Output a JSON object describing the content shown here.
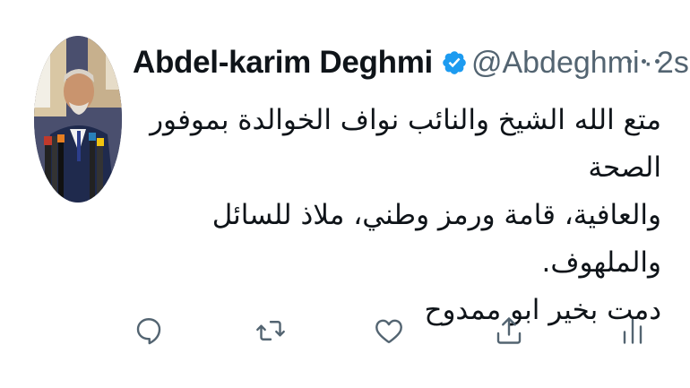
{
  "author": {
    "display_name": "Abdel-karim Deghmi",
    "verified": true,
    "handle": "@Abdeghmi",
    "separator": "·",
    "time": "2s"
  },
  "tweet": {
    "lines": [
      "متع الله الشيخ والنائب نواف الخوالدة بموفور الصحة",
      "والعافية، قامة ورمز وطني، ملاذ للسائل والملهوف.",
      "دمت بخير ابو ممدوح"
    ]
  },
  "actions": [
    {
      "icon": "reply-icon"
    },
    {
      "icon": "retweet-icon"
    },
    {
      "icon": "like-icon"
    },
    {
      "icon": "share-icon"
    },
    {
      "icon": "views-icon"
    }
  ],
  "colors": {
    "text": "#0f1419",
    "secondary": "#536471",
    "verified": "#1d9bf0"
  }
}
